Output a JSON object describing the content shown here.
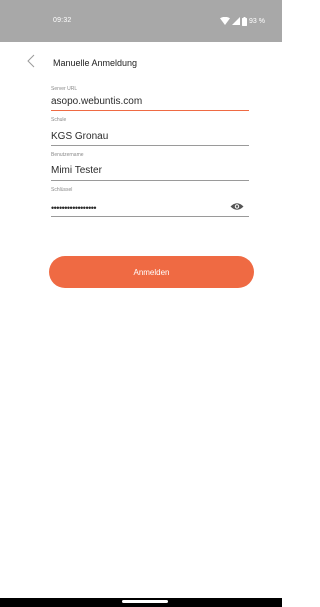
{
  "status_bar": {
    "time": "09:32",
    "battery": "93 %",
    "icons": [
      "wifi-icon",
      "signal-icon",
      "battery-icon"
    ]
  },
  "header": {
    "back_icon": "chevron-left-icon",
    "title": "Manuelle Anmeldung"
  },
  "form": {
    "server_url": {
      "label": "Server URL",
      "value": "asopo.webuntis.com"
    },
    "school": {
      "label": "Schule",
      "value": "KGS Gronau"
    },
    "username": {
      "label": "Benutzername",
      "value": "Mimi Tester"
    },
    "key": {
      "label": "Schlüssel",
      "value": "•••••••••••••••••",
      "eye_icon": "eye-icon"
    }
  },
  "login_button": {
    "label": "Anmelden"
  },
  "colors": {
    "accent": "#ef6a43",
    "status_bar": "#a8a8a8",
    "text": "#2a2a2a",
    "label": "#8a8a8a"
  }
}
